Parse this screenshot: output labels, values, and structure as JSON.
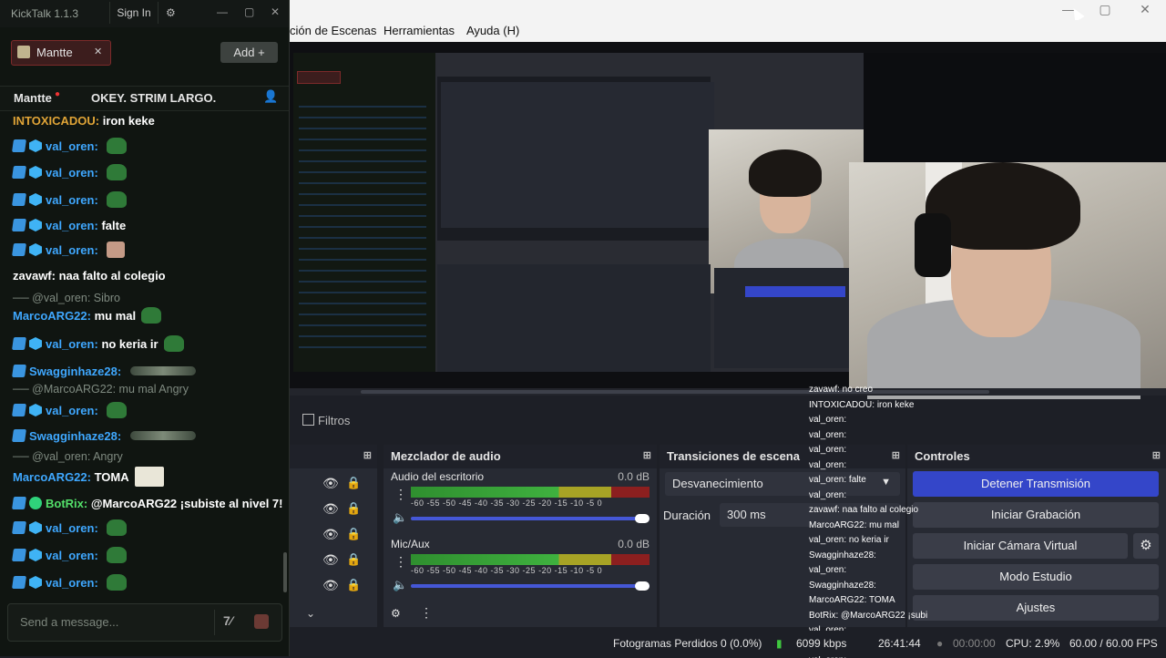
{
  "kicktalk": {
    "title": "KickTalk 1.1.3",
    "sign_in": "Sign In",
    "tab_label": "Mantte",
    "add_label": "Add",
    "channel": "Mantte",
    "stream_title": "OKEY. STRIM LARGO.",
    "input_placeholder": "Send a message...",
    "messages": [
      {
        "user": "INTOXICADOU",
        "color": "#e0a437",
        "text": "iron keke",
        "badges": 0
      },
      {
        "user": "val_oren",
        "color": "#3fa8ff",
        "text": "",
        "emote": "frog",
        "badges": 2
      },
      {
        "user": "val_oren",
        "color": "#3fa8ff",
        "text": "",
        "emote": "frog",
        "badges": 2
      },
      {
        "user": "val_oren",
        "color": "#3fa8ff",
        "text": "",
        "emote": "frog",
        "badges": 2
      },
      {
        "user": "val_oren",
        "color": "#3fa8ff",
        "text": "falte",
        "badges": 2
      },
      {
        "user": "val_oren",
        "color": "#3fa8ff",
        "text": "",
        "emote": "cat",
        "badges": 2
      },
      {
        "user": "zavawf",
        "color": "#ffffff",
        "text": "naa falto al colegio",
        "badges": 0
      },
      {
        "reply": "@val_oren: Sibro"
      },
      {
        "user": "MarcoARG22",
        "color": "#3fa8ff",
        "text": "mu mal",
        "emote": "frog",
        "badges": 0
      },
      {
        "user": "val_oren",
        "color": "#3fa8ff",
        "text": "no keria ir",
        "emote": "frog",
        "badges": 2
      },
      {
        "user": "Swagginhaze28",
        "color": "#3fa8ff",
        "text": "",
        "emote": "long",
        "badges": 1
      },
      {
        "reply": "@MarcoARG22: mu mal Angry"
      },
      {
        "user": "val_oren",
        "color": "#3fa8ff",
        "text": "",
        "emote": "frog",
        "badges": 2
      },
      {
        "user": "Swagginhaze28",
        "color": "#3fa8ff",
        "text": "",
        "emote": "long",
        "badges": 1
      },
      {
        "reply": "@val_oren: Angry"
      },
      {
        "user": "MarcoARG22",
        "color": "#3fa8ff",
        "text": "TOMA",
        "emote": "toma",
        "badges": 0
      },
      {
        "user": "BotRix",
        "color": "#53e06a",
        "text": "@MarcoARG22 ¡subiste al nivel 7!",
        "badges": 3
      },
      {
        "user": "val_oren",
        "color": "#3fa8ff",
        "text": "",
        "emote": "frog",
        "badges": 2
      },
      {
        "user": "val_oren",
        "color": "#3fa8ff",
        "text": "",
        "emote": "frog",
        "badges": 2
      },
      {
        "user": "val_oren",
        "color": "#3fa8ff",
        "text": "",
        "emote": "frog",
        "badges": 2
      }
    ]
  },
  "obs": {
    "menu": [
      "ción de Escenas",
      "Herramientas",
      "Ayuda (H)"
    ],
    "filters_label": "Filtros",
    "mixer": {
      "title": "Mezclador de audio",
      "ticks": "-60 -55 -50 -45 -40 -35 -30 -25 -20 -15 -10 -5 0",
      "channels": [
        {
          "name": "Audio del escritorio",
          "db": "0.0 dB",
          "level_pct": 88
        },
        {
          "name": "Mic/Aux",
          "db": "0.0 dB",
          "level_pct": 70
        }
      ]
    },
    "transitions": {
      "title": "Transiciones de escena",
      "selected": "Desvanecimiento",
      "duration_label": "Duración",
      "duration_value": "300 ms"
    },
    "controls": {
      "title": "Controles",
      "buttons": [
        "Detener Transmisión",
        "Iniciar Grabación",
        "Iniciar Cámara Virtual",
        "Modo Estudio",
        "Ajustes"
      ]
    },
    "status": {
      "dropped": "Fotogramas Perdidos 0 (0.0%)",
      "bitrate": "6099 kbps",
      "live_time": "26:41:44",
      "rec_time": "00:00:00",
      "cpu": "CPU: 2.9%",
      "fps": "60.00 / 60.00 FPS"
    },
    "overlay_chat": [
      "zavawf: no creo",
      "INTOXICADOU: iron keke",
      "val_oren:",
      "val_oren:",
      "val_oren:",
      "val_oren:",
      "val_oren: falte",
      "val_oren:",
      "zavawf: naa falto al colegio",
      "MarcoARG22: mu mal",
      "val_oren: no keria ir",
      "Swagginhaze28:",
      "val_oren:",
      "Swagginhaze28:",
      "MarcoARG22: TOMA",
      "BotRix: @MarcoARG22 ¡subiste al nivel 7!",
      "val_oren:",
      "val_oren:",
      "val_oren:"
    ]
  }
}
